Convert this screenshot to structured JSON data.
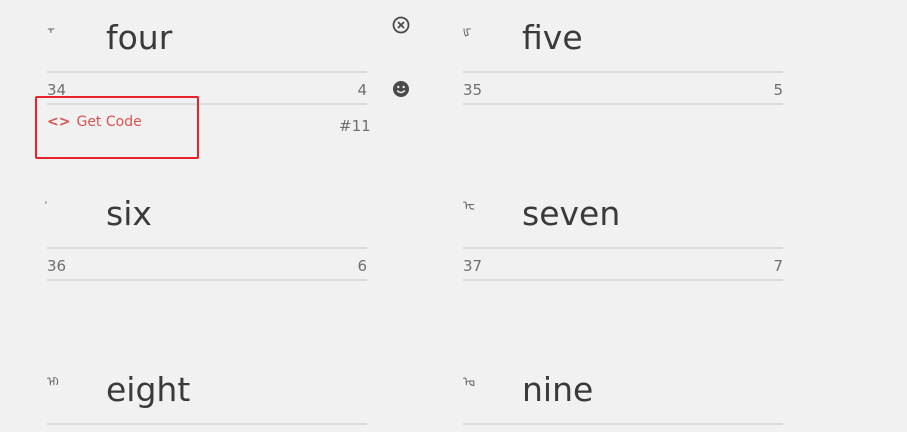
{
  "cards": [
    {
      "glyph": "᠇",
      "word": "four",
      "left_num": "34",
      "right_num": "4"
    },
    {
      "glyph": "ᡁ",
      "word": "five",
      "left_num": "35",
      "right_num": "5"
    },
    {
      "glyph": "ᡃ",
      "word": "six",
      "left_num": "36",
      "right_num": "6"
    },
    {
      "glyph": "ᡄ",
      "word": "seven",
      "left_num": "37",
      "right_num": "7"
    },
    {
      "glyph": "ᡅ",
      "word": "eight",
      "left_num": "",
      "right_num": ""
    },
    {
      "glyph": "ᡆ",
      "word": "nine",
      "left_num": "",
      "right_num": ""
    }
  ],
  "actions": {
    "get_code_label": "Get Code",
    "get_code_icon": "code-icon",
    "tag": "#11",
    "close_icon": "close-circle-icon",
    "smiley_icon": "smiley-icon"
  },
  "colors": {
    "link": "#d9534f",
    "highlight": "#e8232a",
    "background": "#f1f1f1"
  }
}
